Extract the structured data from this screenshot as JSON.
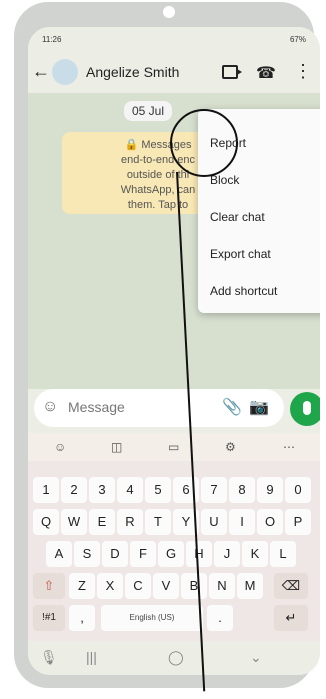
{
  "status": {
    "time": "11:26",
    "right_info": "67%"
  },
  "chat_header": {
    "contact_name": "Angelize Smith"
  },
  "chat": {
    "date_chip": "05 Jul",
    "encryption_note_lines": [
      "Messages",
      "end-to-end enc",
      "outside of thi",
      "WhatsApp, can",
      "them. Tap to"
    ]
  },
  "menu": {
    "items": [
      "Report",
      "Block",
      "Clear chat",
      "Export chat",
      "Add shortcut"
    ]
  },
  "composer": {
    "placeholder": "Message"
  },
  "keyboard": {
    "row_numbers": [
      "1",
      "2",
      "3",
      "4",
      "5",
      "6",
      "7",
      "8",
      "9",
      "0"
    ],
    "row_q": [
      "Q",
      "W",
      "E",
      "R",
      "T",
      "Y",
      "U",
      "I",
      "O",
      "P"
    ],
    "row_a": [
      "A",
      "S",
      "D",
      "F",
      "G",
      "H",
      "J",
      "K",
      "L"
    ],
    "row_z": [
      "Z",
      "X",
      "C",
      "V",
      "B",
      "N",
      "M"
    ],
    "symbol_key": "!#1",
    "comma_key": ",",
    "space_label": "English (US)",
    "dot_key": ".",
    "enter_symbol": "↵",
    "shift_symbol": "⇧",
    "backspace_symbol": "⌫"
  },
  "icons": {
    "back": "arrow-left-icon",
    "avatar": "avatar-icon",
    "video": "video-call-icon",
    "call": "phone-icon",
    "more": "more-vertical-icon",
    "emoji": "emoji-icon",
    "attach": "attach-icon",
    "camera": "camera-icon",
    "mic": "mic-icon"
  },
  "colors": {
    "mic": "#1fa64a",
    "chat_bg": "#d7dfcf",
    "note_bg": "#f8e8b5",
    "menu_bg": "#fafafa"
  }
}
